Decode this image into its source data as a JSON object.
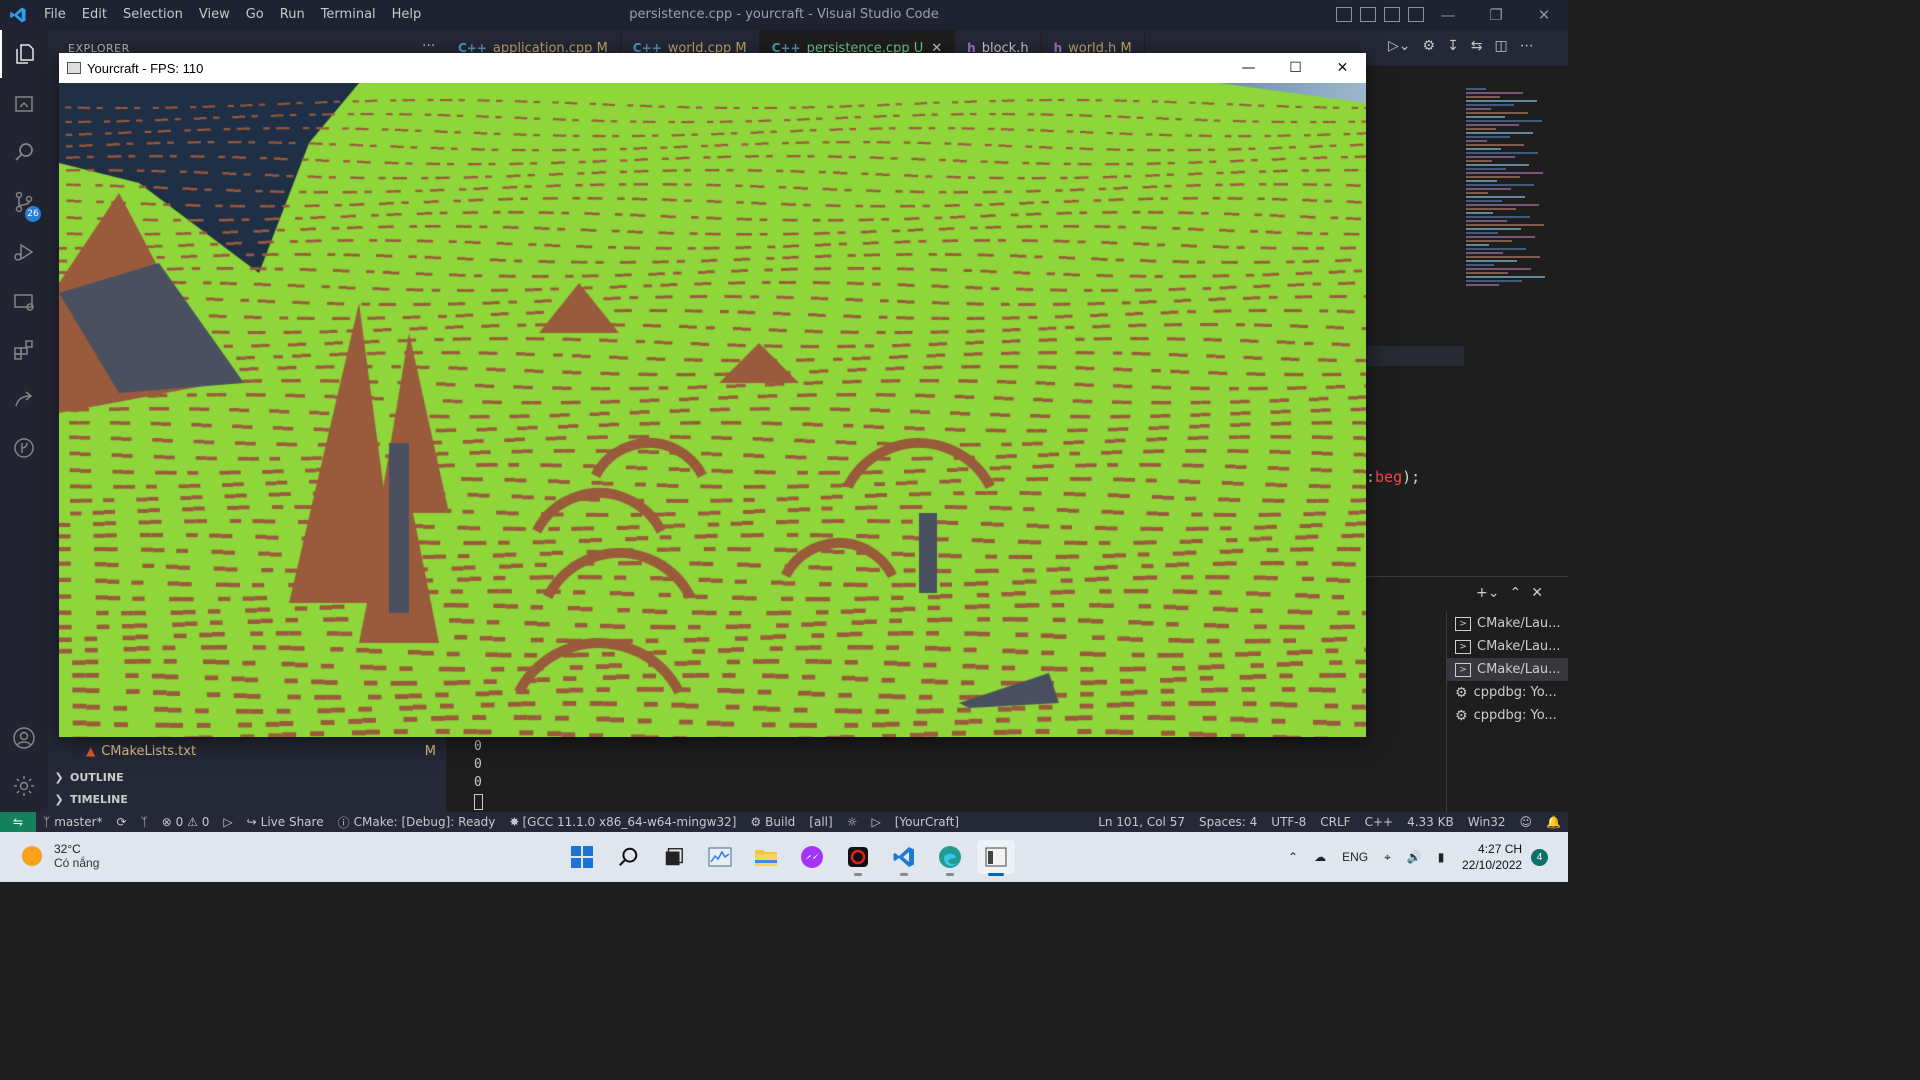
{
  "vscode": {
    "window_title": "persistence.cpp - yourcraft - Visual Studio Code",
    "menu": [
      "File",
      "Edit",
      "Selection",
      "View",
      "Go",
      "Run",
      "Terminal",
      "Help"
    ],
    "scm_badge": "26",
    "explorer_header": "EXPLORER",
    "explorer_more": "···",
    "tabs": [
      {
        "icon": "C++",
        "label": "application.cpp",
        "flag": "M"
      },
      {
        "icon": "C++",
        "label": "world.cpp",
        "flag": "M"
      },
      {
        "icon": "C++",
        "label": "persistence.cpp",
        "flag": "U"
      },
      {
        "icon": "h",
        "label": "block.h",
        "flag": ""
      },
      {
        "icon": "h",
        "label": "world.h",
        "flag": "M"
      }
    ],
    "visible_code_fragment": {
      "op": ":",
      "name": "beg",
      "tail": ");"
    },
    "sidebar": {
      "file": {
        "name": "CMakeLists.txt",
        "flag": "M"
      },
      "outline": "OUTLINE",
      "timeline": "TIMELINE"
    },
    "terminal_output": [
      "0",
      "0",
      "0"
    ],
    "terminals": [
      {
        "label": "CMake/Lau...",
        "icon": "terminal-icon"
      },
      {
        "label": "CMake/Lau...",
        "icon": "terminal-icon"
      },
      {
        "label": "CMake/Lau...",
        "icon": "terminal-icon"
      },
      {
        "label": "cppdbg: Yo...",
        "icon": "debug-icon"
      },
      {
        "label": "cppdbg: Yo...",
        "icon": "debug-icon"
      }
    ],
    "status_left": {
      "branch": "master*",
      "errors": "0",
      "warnings": "0",
      "live_share": "Live Share",
      "cmake": "CMake: [Debug]: Ready",
      "kit": "[GCC 11.1.0 x86_64-w64-mingw32]",
      "build": "Build",
      "target": "[all]",
      "launch_target": "[YourCraft]"
    },
    "status_right": {
      "position": "Ln 101, Col 57",
      "spaces": "Spaces: 4",
      "encoding": "UTF-8",
      "eol": "CRLF",
      "language": "C++",
      "size": "4.33 KB",
      "platform": "Win32"
    }
  },
  "game_window": {
    "title": "Yourcraft - FPS: 110",
    "colors": {
      "grass": "#8fd63a",
      "dirt": "#9a5a3c",
      "stone": "#4a5060",
      "water": "#1f2f45"
    }
  },
  "taskbar": {
    "weather": {
      "temp": "32°C",
      "desc": "Có nắng"
    },
    "language": "ENG",
    "time": "4:27 CH",
    "date": "22/10/2022",
    "notifications": "4"
  }
}
